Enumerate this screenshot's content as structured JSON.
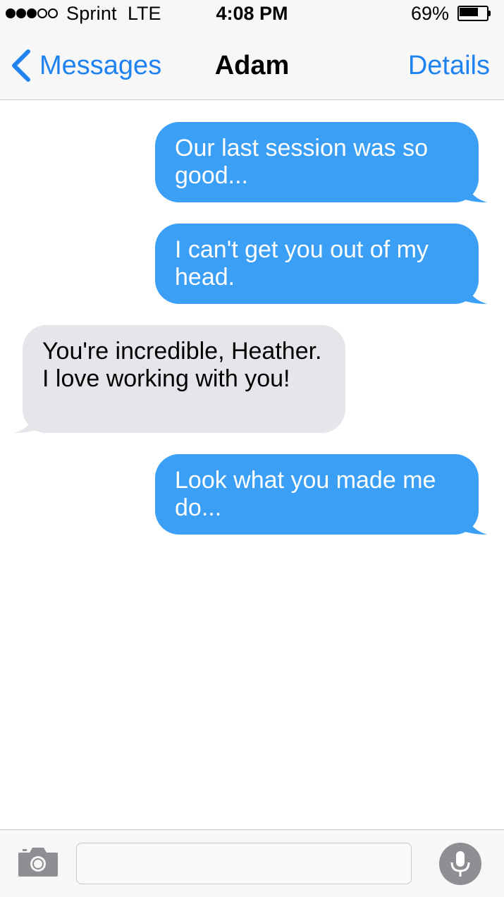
{
  "status_bar": {
    "signal_filled": 3,
    "signal_total": 5,
    "carrier": "Sprint",
    "network": "LTE",
    "time": "4:08 PM",
    "battery_percent_label": "69%",
    "battery_level": 0.69
  },
  "nav": {
    "back_label": "Messages",
    "title": "Adam",
    "details_label": "Details",
    "accent_color": "#1e82f0"
  },
  "messages": [
    {
      "direction": "sent",
      "text": "Our last session was so good..."
    },
    {
      "direction": "sent",
      "text": "I can't get you out of my head."
    },
    {
      "direction": "received",
      "text": "You're incredible, Heather. I love working with you!"
    },
    {
      "direction": "sent",
      "text": "Look what you made me do..."
    }
  ],
  "colors": {
    "sent_bubble": "#3a9ff5",
    "received_bubble": "#e5e5ea",
    "bar_background": "#f7f7f8"
  },
  "input_bar": {
    "camera_icon": "camera-icon",
    "message_value": "",
    "mic_icon": "microphone-icon"
  }
}
